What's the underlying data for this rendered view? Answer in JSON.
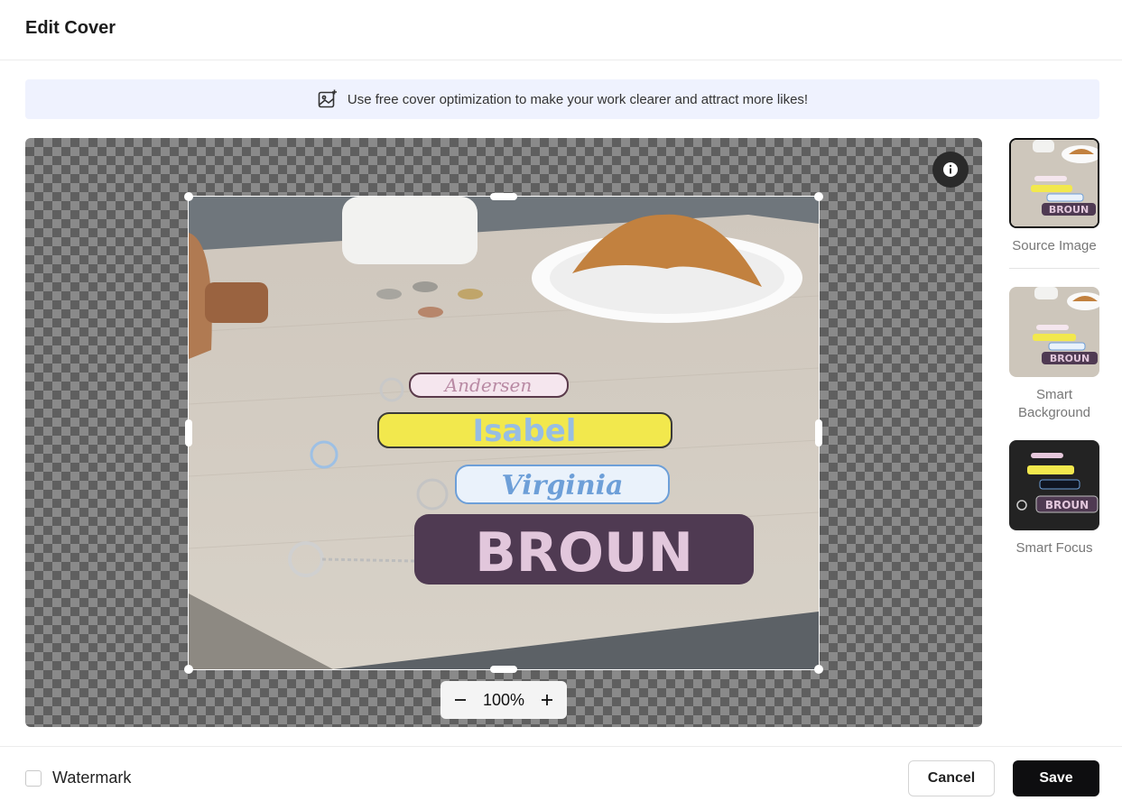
{
  "dialog": {
    "title": "Edit Cover"
  },
  "banner": {
    "icon": "image-sparkle-icon",
    "text": "Use free cover optimization to make your work clearer and attract more likes!"
  },
  "editor": {
    "zoom_label": "100%",
    "photo_text": [
      "Andersen",
      "Isabel",
      "Virginia",
      "BROUN"
    ]
  },
  "options": [
    {
      "label": "Source Image",
      "selected": true
    },
    {
      "label": "Smart Background",
      "selected": false
    },
    {
      "label": "Smart Focus",
      "selected": false
    }
  ],
  "footer": {
    "watermark_label": "Watermark",
    "watermark_checked": false,
    "cancel_label": "Cancel",
    "save_label": "Save"
  },
  "colors": {
    "accent": "#0e0e10",
    "banner_bg": "#eff2fe",
    "checker_dark": "#5f5f5f",
    "checker_light": "#8a8a8a"
  }
}
